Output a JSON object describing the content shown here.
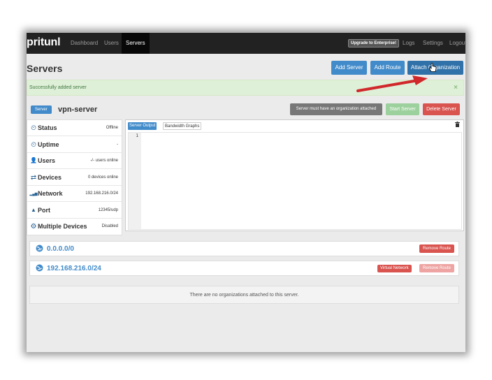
{
  "navbar": {
    "brand": "pritunl",
    "items": [
      {
        "label": "Dashboard",
        "active": false
      },
      {
        "label": "Users",
        "active": false
      },
      {
        "label": "Servers",
        "active": true
      }
    ],
    "upgrade_label": "Upgrade to Enterprise!",
    "right_items": [
      "Logs",
      "Settings",
      "Logout"
    ]
  },
  "header": {
    "title": "Servers",
    "add_server": "Add Server",
    "add_route": "Add Route",
    "attach_org": "Attach Organization"
  },
  "alert": {
    "text": "Successfully added server",
    "close": "×"
  },
  "server": {
    "badge": "Server",
    "name": "vpn-server",
    "status_note": "Server must have an organization attached",
    "start": "Start Server",
    "delete": "Delete Server",
    "info": [
      {
        "icon": "status-icon",
        "glyph": "⏲",
        "label": "Status",
        "value": "Offline"
      },
      {
        "icon": "uptime-icon",
        "glyph": "⏲",
        "label": "Uptime",
        "value": "-"
      },
      {
        "icon": "users-icon",
        "glyph": "👤",
        "label": "Users",
        "value": "-/- users online"
      },
      {
        "icon": "devices-icon",
        "glyph": "⇄",
        "label": "Devices",
        "value": "0 devices online"
      },
      {
        "icon": "network-icon",
        "glyph": "▂▄▆",
        "label": "Network",
        "value": "192.168.216.0/24"
      },
      {
        "icon": "port-icon",
        "glyph": "▲",
        "label": "Port",
        "value": "12345/udp"
      },
      {
        "icon": "gear-icon",
        "glyph": "⚙",
        "label": "Multiple Devices",
        "value": "Disabled"
      }
    ],
    "tabs": {
      "output": "Server Output",
      "bandwidth": "Bandwidth Graphs"
    },
    "editor_line": "1"
  },
  "routes": [
    {
      "network": "0.0.0.0/0",
      "virtual_label": "",
      "remove": "Remove Route"
    },
    {
      "network": "192.168.216.0/24",
      "virtual_label": "Virtual Network",
      "remove": "Remove Route"
    }
  ],
  "organizations": {
    "empty_text": "There are no organizations attached to this server."
  },
  "colors": {
    "primary": "#428bca",
    "danger": "#d9534f",
    "success_bg": "#dff0d8",
    "navbar": "#222222",
    "annotation_arrow": "#d0282b"
  }
}
